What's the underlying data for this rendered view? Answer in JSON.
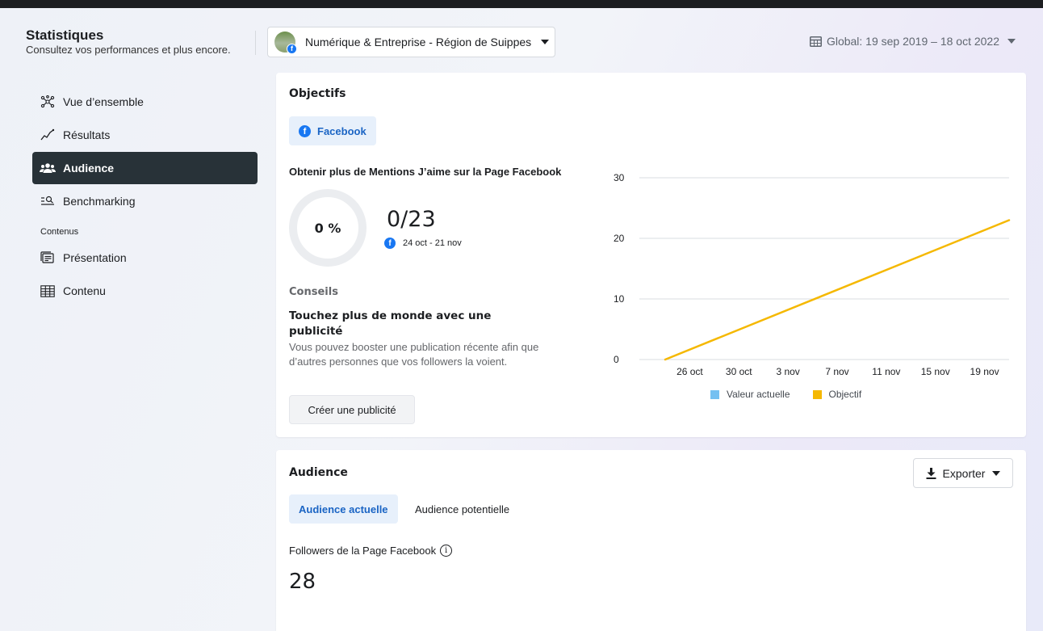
{
  "header": {
    "title": "Statistiques",
    "subtitle": "Consultez vos performances et plus encore.",
    "page_selector": "Numérique & Entreprise - Région de Suippes",
    "date_range": "Global: 19 sep 2019 – 18 oct 2022"
  },
  "sidebar": {
    "items": [
      {
        "label": "Vue d’ensemble",
        "icon": "overview-icon"
      },
      {
        "label": "Résultats",
        "icon": "results-icon"
      },
      {
        "label": "Audience",
        "icon": "people-icon",
        "active": true
      },
      {
        "label": "Benchmarking",
        "icon": "benchmark-icon"
      }
    ],
    "section_label": "Contenus",
    "content_items": [
      {
        "label": "Présentation",
        "icon": "presentation-icon"
      },
      {
        "label": "Contenu",
        "icon": "table-icon"
      }
    ]
  },
  "objectifs": {
    "title": "Objectifs",
    "platform_tab": "Facebook",
    "goal_title": "Obtenir plus de Mentions J’aime sur la Page Facebook",
    "progress_percent": "0 %",
    "progress_fraction": 0,
    "goal_value": "0/23",
    "goal_range": "24 oct - 21 nov",
    "conseils_label": "Conseils",
    "conseils_title": "Touchez plus de monde avec une publicité",
    "conseils_text": "Vous pouvez booster une publication récente afin que d’autres personnes que vos followers la voient.",
    "create_button": "Créer une publicité"
  },
  "chart_data": {
    "type": "line",
    "categories": [
      "26 oct",
      "30 oct",
      "3 nov",
      "7 nov",
      "11 nov",
      "15 nov",
      "19 nov"
    ],
    "y_ticks": [
      "0",
      "10",
      "20",
      "30"
    ],
    "ylim": [
      0,
      30
    ],
    "x_span": [
      "24 oct",
      "21 nov"
    ],
    "series": [
      {
        "name": "Valeur actuelle",
        "color": "#74c0f1",
        "values": []
      },
      {
        "name": "Objectif",
        "color": "#f5b800",
        "start": 0,
        "end": 23
      }
    ],
    "legend_position": "bottom",
    "grid": true
  },
  "audience": {
    "title": "Audience",
    "export_button": "Exporter",
    "tab_current": "Audience actuelle",
    "tab_potential": "Audience potentielle",
    "followers_label": "Followers de la Page Facebook",
    "followers_value": "28"
  },
  "colors": {
    "accent": "#1a64c4",
    "sidebar_active": "#283238",
    "facebook": "#1877f2"
  }
}
